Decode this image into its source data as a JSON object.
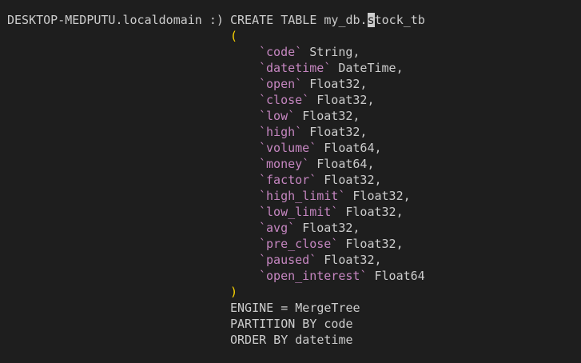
{
  "prompt": "DESKTOP-MEDPUTU.localdomain :)",
  "statement": {
    "create_before_cursor": "CREATE TABLE my_db.",
    "cursor_char": "s",
    "create_after_cursor": "tock_tb",
    "open_paren": "(",
    "close_paren": ")",
    "columns": [
      {
        "name": "code",
        "type": "String,"
      },
      {
        "name": "datetime",
        "type": "DateTime,"
      },
      {
        "name": "open",
        "type": "Float32,"
      },
      {
        "name": "close",
        "type": "Float32,"
      },
      {
        "name": "low",
        "type": "Float32,"
      },
      {
        "name": "high",
        "type": "Float32,"
      },
      {
        "name": "volume",
        "type": "Float64,"
      },
      {
        "name": "money",
        "type": "Float64,"
      },
      {
        "name": "factor",
        "type": "Float32,"
      },
      {
        "name": "high_limit",
        "type": "Float32,"
      },
      {
        "name": "low_limit",
        "type": "Float32,"
      },
      {
        "name": "avg",
        "type": "Float32,"
      },
      {
        "name": "pre_close",
        "type": "Float32,"
      },
      {
        "name": "paused",
        "type": "Float32,"
      },
      {
        "name": "open_interest",
        "type": "Float64"
      }
    ],
    "engine": "ENGINE = MergeTree",
    "partition": "PARTITION BY code",
    "order": "ORDER BY datetime"
  },
  "colors": {
    "background": "#1e1e1e",
    "text": "#cccccc",
    "column_name": "#c586c0",
    "paren": "#ffd700"
  }
}
